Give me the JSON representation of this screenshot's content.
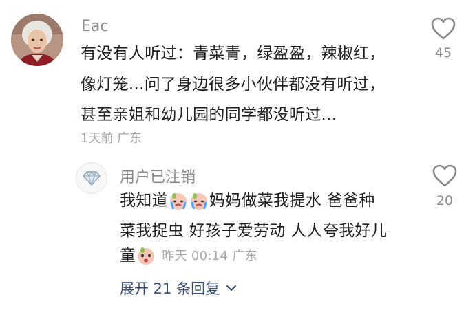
{
  "comments": [
    {
      "username": "Eac",
      "lines": [
        "有没有人听过：青菜青，绿盈盈，辣椒红，",
        "像灯笼...问了身边很多小伙伴都没有听过，",
        "甚至亲姐和幼儿园的同学都没听过..."
      ],
      "meta": "1天前 广东",
      "likes": "45",
      "avatar_icon": "user-photo-avatar",
      "like_icon": "heart-outline-icon"
    },
    {
      "username": "用户已注销",
      "line1_a": "我知道",
      "line1_b": "妈妈做菜我提水 爸爸种",
      "line2": "菜我捉虫 好孩子爱劳动 人人夸我好儿",
      "line3_a": "童",
      "meta": "昨天 00:14 广东",
      "likes": "20",
      "avatar_icon": "diamond-icon",
      "emojis": [
        "crying-face-emoji",
        "crying-face-emoji",
        "peach-face-emoji"
      ],
      "like_icon": "heart-outline-icon"
    }
  ],
  "expand": {
    "label": "展开 21 条回复",
    "icon": "chevron-down-icon"
  }
}
